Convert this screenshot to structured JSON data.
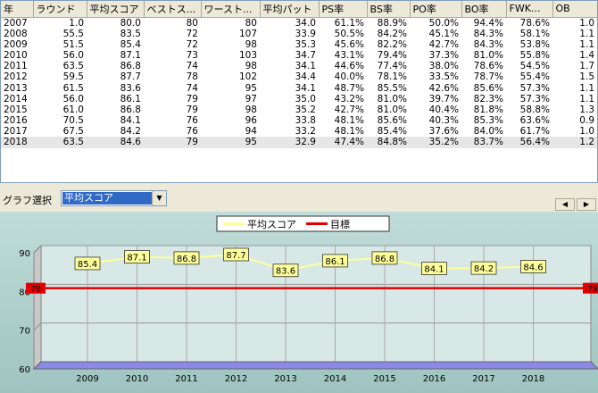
{
  "table": {
    "headers": [
      "年",
      "ラウンド",
      "平均スコア",
      "ベストス...",
      "ワースト...",
      "平均パット",
      "PS率",
      "BS率",
      "PO率",
      "BO率",
      "FWK...",
      "OB"
    ],
    "rows": [
      [
        "2007",
        "1.0",
        "80.0",
        "80",
        "80",
        "34.0",
        "61.1%",
        "88.9%",
        "50.0%",
        "94.4%",
        "78.6%",
        "1.0"
      ],
      [
        "2008",
        "55.5",
        "83.5",
        "72",
        "107",
        "33.9",
        "50.5%",
        "84.2%",
        "45.1%",
        "84.3%",
        "58.1%",
        "1.1"
      ],
      [
        "2009",
        "51.5",
        "85.4",
        "72",
        "98",
        "35.3",
        "45.6%",
        "82.2%",
        "42.7%",
        "84.3%",
        "53.8%",
        "1.1"
      ],
      [
        "2010",
        "56.0",
        "87.1",
        "73",
        "103",
        "34.7",
        "43.1%",
        "79.4%",
        "37.3%",
        "81.0%",
        "55.8%",
        "1.4"
      ],
      [
        "2011",
        "63.5",
        "86.8",
        "74",
        "98",
        "34.1",
        "44.6%",
        "77.4%",
        "38.0%",
        "78.6%",
        "54.5%",
        "1.7"
      ],
      [
        "2012",
        "59.5",
        "87.7",
        "78",
        "102",
        "34.4",
        "40.0%",
        "78.1%",
        "33.5%",
        "78.7%",
        "55.4%",
        "1.5"
      ],
      [
        "2013",
        "61.5",
        "83.6",
        "74",
        "95",
        "34.1",
        "48.7%",
        "85.5%",
        "42.6%",
        "85.6%",
        "57.3%",
        "1.1"
      ],
      [
        "2014",
        "56.0",
        "86.1",
        "79",
        "97",
        "35.0",
        "43.2%",
        "81.0%",
        "39.7%",
        "82.3%",
        "57.3%",
        "1.1"
      ],
      [
        "2015",
        "61.0",
        "86.8",
        "79",
        "98",
        "35.2",
        "42.7%",
        "81.0%",
        "40.4%",
        "81.8%",
        "58.8%",
        "1.3"
      ],
      [
        "2016",
        "70.5",
        "84.1",
        "76",
        "96",
        "33.8",
        "48.1%",
        "85.6%",
        "40.3%",
        "85.3%",
        "63.6%",
        "0.9"
      ],
      [
        "2017",
        "67.5",
        "84.2",
        "76",
        "94",
        "33.2",
        "48.1%",
        "85.4%",
        "37.6%",
        "84.0%",
        "61.7%",
        "1.0"
      ],
      [
        "2018",
        "63.5",
        "84.6",
        "79",
        "95",
        "32.9",
        "47.4%",
        "84.8%",
        "35.2%",
        "83.7%",
        "56.4%",
        "1.2"
      ]
    ],
    "selected_row": 11
  },
  "toolbar": {
    "graph_label": "グラフ選択",
    "graph_value": "平均スコア",
    "dropdown_icon": "triangle-down-icon",
    "prev_icon": "triangle-left-icon",
    "next_icon": "triangle-right-icon"
  },
  "chart_data": {
    "type": "line",
    "x": [
      2009,
      2010,
      2011,
      2012,
      2013,
      2014,
      2015,
      2016,
      2017,
      2018
    ],
    "series": [
      {
        "name": "平均スコア",
        "values": [
          85.4,
          87.1,
          86.8,
          87.7,
          83.6,
          86.1,
          86.8,
          84.1,
          84.2,
          84.6
        ],
        "color": "#ffff99"
      },
      {
        "name": "目標",
        "values": [
          79,
          79,
          79,
          79,
          79,
          79,
          79,
          79,
          79,
          79
        ],
        "color": "#e00000"
      }
    ],
    "target_label": "79",
    "ylim": [
      60,
      90
    ],
    "yticks": [
      60,
      70,
      80,
      90
    ],
    "grid": true,
    "legend": "top-center"
  },
  "colors": {
    "chart_bg_top": "#c0dcd8",
    "chart_bg_bottom": "#9fc4bf",
    "floor": "#8a8ae6",
    "label_bg": "#ffff99",
    "target_line": "#e00000"
  }
}
